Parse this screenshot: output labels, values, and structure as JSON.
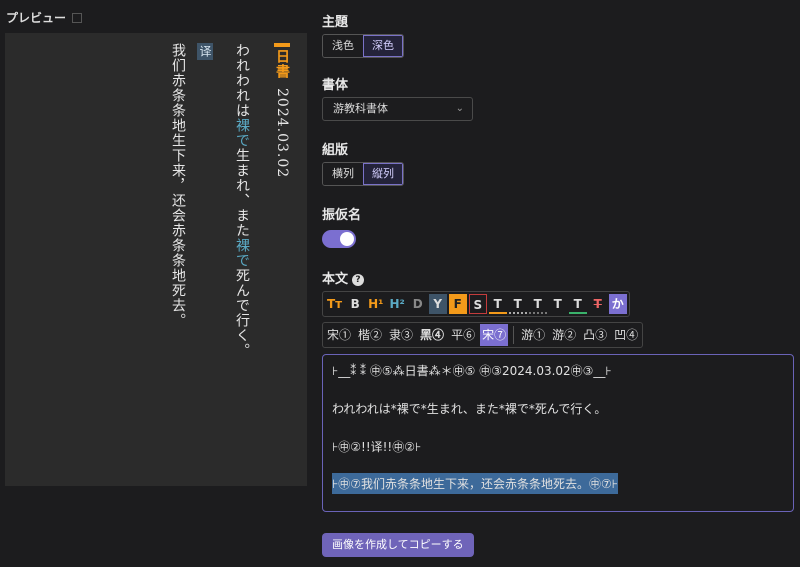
{
  "preview": {
    "title": "プレビュー",
    "col1_date": "2024.03.02",
    "col1_tag": "日書",
    "col2_a": "われわれは",
    "col2_b": "裸で",
    "col2_c": "生まれ、また",
    "col2_d": "裸で",
    "col2_e": "死んで行く。",
    "col3_tag": "译",
    "col4": "我们赤条条地生下来，还会赤条条地死去。"
  },
  "settings": {
    "theme_label": "主題",
    "theme_options": [
      "浅色",
      "深色"
    ],
    "font_label": "書体",
    "font_value": "游教科書体",
    "layout_label": "組版",
    "layout_options": [
      "横列",
      "縦列"
    ],
    "furigana_label": "振仮名",
    "body_label": "本文"
  },
  "toolbar": {
    "items": [
      "Tт",
      "B",
      "H¹",
      "H²",
      "D",
      "Y",
      "F",
      "S",
      "T",
      "T",
      "T",
      "T",
      "T",
      "T",
      "か"
    ]
  },
  "fontbar": {
    "items": [
      "宋①",
      "楷②",
      "隶③",
      "黑④",
      "平⑥",
      "宋⑦",
      "游①",
      "游②",
      "凸③",
      "凹④"
    ]
  },
  "editor": {
    "line1": "⊦__⁑ ⁑ ㊥⑤⁂日書⁂＊㊥⑤ ㊥③2024.03.02㊥③__⊦",
    "line2": "われわれは*裸で*生まれ、また*裸で*死んで行く。",
    "line3": "⊦㊥②!!译!!㊥②⊦",
    "line4": "⊦㊥⑦我们赤条条地生下来，还会赤条条地死去。㊥⑦⊦"
  },
  "actions": {
    "create_label": "画像を作成してコピーする"
  }
}
